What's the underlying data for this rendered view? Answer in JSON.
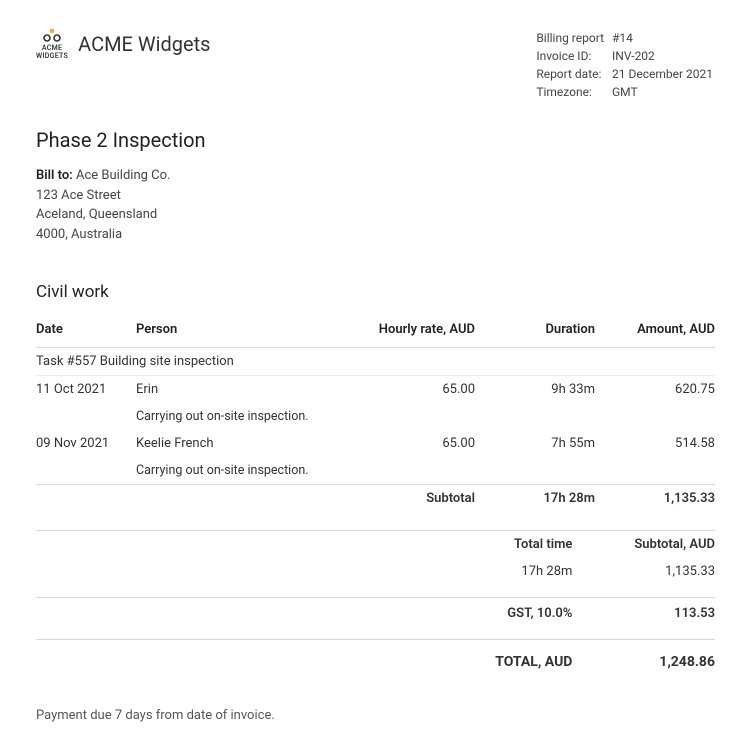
{
  "header": {
    "company_name": "ACME Widgets",
    "logo_line1": "ACME",
    "logo_line2": "WIDGETS",
    "meta": {
      "billing_report_label": "Billing report",
      "billing_report_value": "#14",
      "invoice_id_label": "Invoice ID:",
      "invoice_id_value": "INV-202",
      "report_date_label": "Report date:",
      "report_date_value": "21 December 2021",
      "timezone_label": "Timezone:",
      "timezone_value": "GMT"
    }
  },
  "project": {
    "title": "Phase 2 Inspection"
  },
  "billto": {
    "label": "Bill to:",
    "name": "Ace Building Co.",
    "street": "123 Ace Street",
    "city": "Aceland, Queensland",
    "postal": "4000, Australia"
  },
  "section": {
    "title": "Civil work",
    "columns": {
      "date": "Date",
      "person": "Person",
      "rate": "Hourly rate, AUD",
      "duration": "Duration",
      "amount": "Amount, AUD"
    },
    "task_title": "Task #557 Building site inspection",
    "entries": [
      {
        "date": "11 Oct 2021",
        "person": "Erin",
        "desc": "Carrying out on-site inspection.",
        "rate": "65.00",
        "duration": "9h 33m",
        "amount": "620.75"
      },
      {
        "date": "09 Nov 2021",
        "person": "Keelie French",
        "desc": "Carrying out on-site inspection.",
        "rate": "65.00",
        "duration": "7h 55m",
        "amount": "514.58"
      }
    ],
    "subtotal_label": "Subtotal",
    "subtotal_duration": "17h 28m",
    "subtotal_amount": "1,135.33"
  },
  "totals": {
    "total_time_label": "Total time",
    "subtotal_label": "Subtotal, AUD",
    "total_time_value": "17h 28m",
    "subtotal_value": "1,135.33",
    "gst_label": "GST, 10.0%",
    "gst_value": "113.53",
    "total_label": "TOTAL, AUD",
    "total_value": "1,248.86"
  },
  "footer": {
    "note": "Payment due 7 days from date of invoice."
  }
}
